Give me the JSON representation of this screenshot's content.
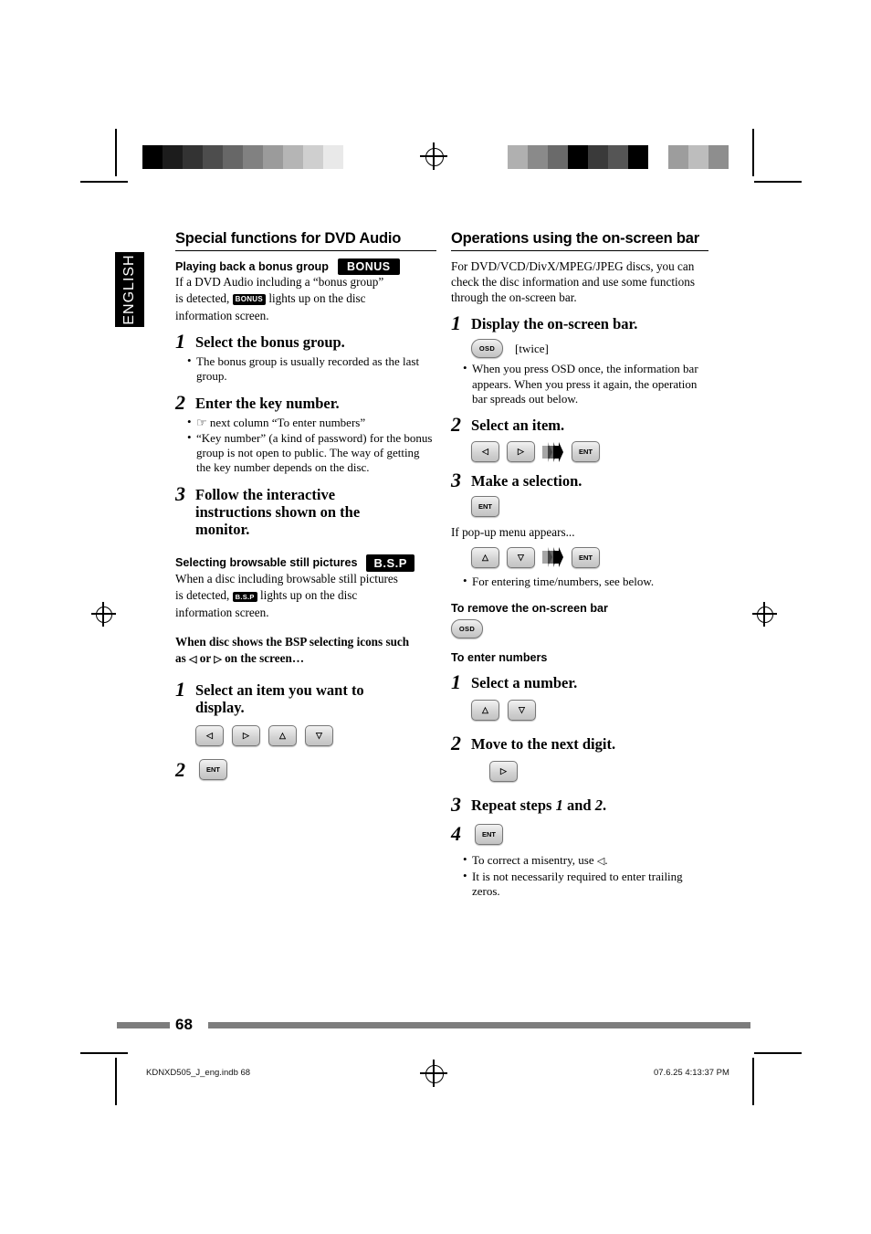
{
  "page": {
    "language_tab": "ENGLISH",
    "page_number": "68",
    "footer_left": "KDNXD505_J_eng.indb   68",
    "footer_right": "07.6.25   4:13:37 PM"
  },
  "left_column": {
    "title": "Special functions for DVD Audio",
    "section1": {
      "heading": "Playing back a bonus group",
      "badge": "BONUS",
      "intro_1": "If a DVD Audio including a “bonus group”",
      "intro_2a": "is detected, ",
      "intro_badge": "BONUS",
      "intro_2b": " lights up on the disc",
      "intro_3": "information screen.",
      "steps": [
        {
          "num": "1",
          "text": "Select the bonus group.",
          "bullets": [
            "The bonus group is usually recorded as the last group."
          ]
        },
        {
          "num": "2",
          "text": "Enter the key number.",
          "bullets": [
            "☞ next column “To enter numbers”",
            "“Key number” (a kind of password) for the bonus group is not open to public. The way of getting the key number depends on the disc."
          ]
        },
        {
          "num": "3",
          "text": "Follow the interactive instructions shown on the monitor.",
          "bullets": []
        }
      ]
    },
    "section2": {
      "heading": "Selecting browsable still pictures",
      "badge": "B.S.P",
      "intro_1": "When a disc including browsable still pictures",
      "intro_2a": "is detected, ",
      "intro_badge": "B.S.P",
      "intro_2b": " lights up on the disc",
      "intro_3": "information screen.",
      "note_line1": "When disc shows the BSP selecting icons such",
      "note_line2a": "as ",
      "note_icon1": "◁",
      "note_line2b": " or ",
      "note_icon2": "▷",
      "note_line2c": " on the screen…",
      "steps": [
        {
          "num": "1",
          "text": "Select an item you want to display.",
          "keys": [
            "◁",
            "▷",
            "△",
            "▽"
          ]
        },
        {
          "num": "2",
          "text": "",
          "keys": [
            "ENT"
          ]
        }
      ]
    }
  },
  "right_column": {
    "title": "Operations using the on-screen bar",
    "intro": "For DVD/VCD/DivX/MPEG/JPEG discs, you can check the disc information and use some functions through the on-screen bar.",
    "steps": [
      {
        "num": "1",
        "text": "Display the on-screen bar.",
        "key": "OSD",
        "key_note": "[twice]",
        "bullets": [
          "When you press OSD once, the information bar appears. When you press it again, the operation bar spreads out below."
        ]
      },
      {
        "num": "2",
        "text": "Select an item.",
        "keys": [
          "◁",
          "▷",
          "scroll",
          "ENT"
        ]
      },
      {
        "num": "3",
        "text": "Make a selection.",
        "keys": [
          "ENT"
        ],
        "after_text": "If pop-up menu appears...",
        "keys2": [
          "△",
          "▽",
          "scroll",
          "ENT"
        ],
        "bullets": [
          "For entering time/numbers, see below."
        ]
      }
    ],
    "remove_heading": "To remove the on-screen bar",
    "remove_key": "OSD",
    "enter_heading": "To enter numbers",
    "enter_steps": [
      {
        "num": "1",
        "text": "Select a number.",
        "keys": [
          "△",
          "▽"
        ]
      },
      {
        "num": "2",
        "text": "Move to the next digit.",
        "keys": [
          "▷"
        ]
      },
      {
        "num": "3",
        "text_a": "Repeat steps ",
        "text_i1": "1",
        "text_b": " and ",
        "text_i2": "2",
        "text_c": ".",
        "keys": []
      },
      {
        "num": "4",
        "text": "",
        "keys": [
          "ENT"
        ]
      }
    ],
    "final_bullets_a": "To correct a misentry, use ",
    "final_bullets_icon": "◁",
    "final_bullets_b": ".",
    "final_bullet2": "It is not necessarily required to enter trailing zeros."
  },
  "colorbars": {
    "left": [
      "#000000",
      "#1c1c1c",
      "#333333",
      "#4d4d4d",
      "#676767",
      "#818181",
      "#9b9b9b",
      "#b5b5b5",
      "#cfcfcf",
      "#e9e9e9",
      "#ffffff"
    ],
    "right": [
      "#b0b0b0",
      "#8a8a8a",
      "#6a6a6a",
      "#000000",
      "#3a3a3a",
      "#555555",
      "#000000",
      "#ffffff",
      "#9d9d9d",
      "#bdbdbd",
      "#8e8e8e"
    ]
  }
}
